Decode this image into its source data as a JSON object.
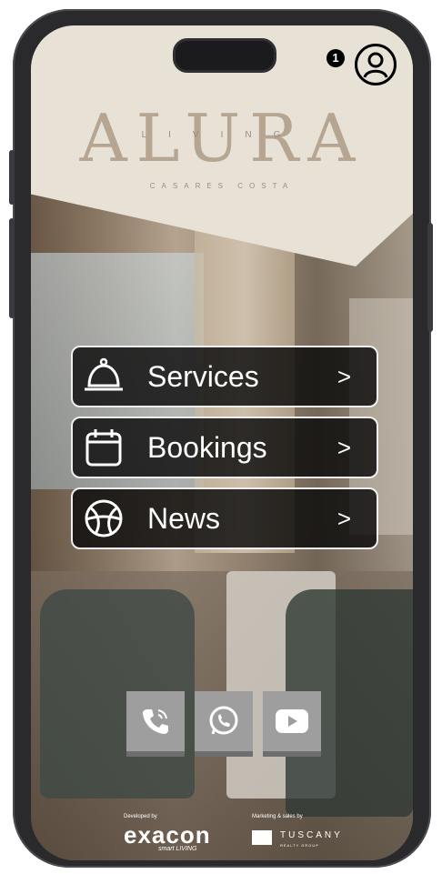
{
  "brand": {
    "wordmark": "ALURA",
    "sub": "LIVING",
    "location": "CASARES COSTA"
  },
  "notifications": {
    "count": "1"
  },
  "menu": {
    "items": [
      {
        "label": "Services",
        "chevron": ">",
        "icon": "bell-icon"
      },
      {
        "label": "Bookings",
        "chevron": ">",
        "icon": "calendar-icon"
      },
      {
        "label": "News",
        "chevron": ">",
        "icon": "basketball-icon"
      }
    ]
  },
  "social": [
    {
      "icon": "phone-icon"
    },
    {
      "icon": "whatsapp-icon"
    },
    {
      "icon": "youtube-icon"
    }
  ],
  "footer": {
    "developed_by": "Developed by",
    "developer": "exacon",
    "developer_tagline": "smart LIVING",
    "marketing_by": "Marketing & sales by",
    "marketer": "TUSCANY",
    "marketer_tagline": "REALTY GROUP"
  },
  "colors": {
    "header_bg": "#e7e1d6",
    "brand_text": "#b6a591",
    "menu_bg": "#0a0a0a",
    "social_bg": "#9e9e9e"
  }
}
